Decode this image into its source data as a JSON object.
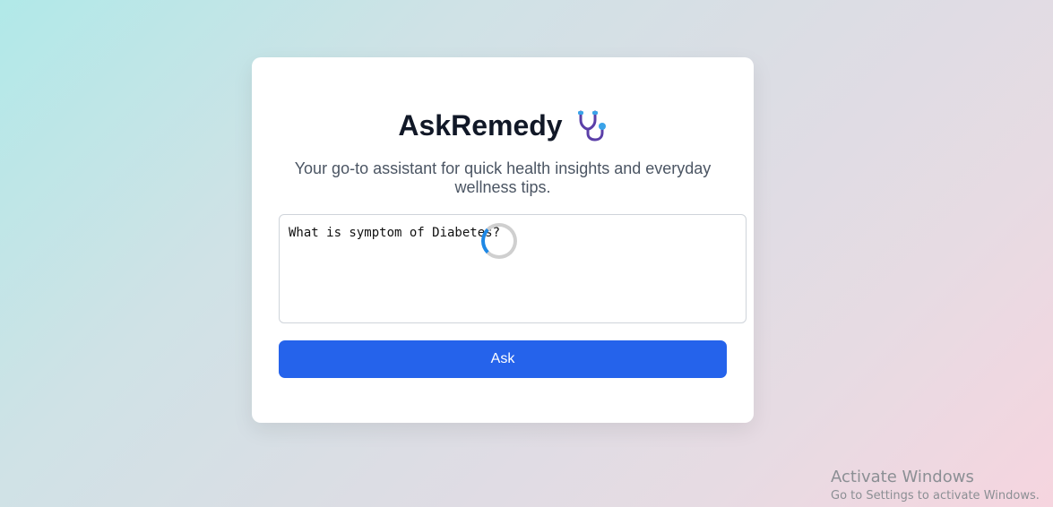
{
  "app": {
    "title": "AskRemedy",
    "icon": "stethoscope-icon",
    "subtitle": "Your go-to assistant for quick health insights and everyday wellness tips."
  },
  "query": {
    "value": "What is symptom of Diabetes?"
  },
  "actions": {
    "ask_label": "Ask"
  },
  "status": {
    "loading": true
  },
  "watermark": {
    "line1": "Activate Windows",
    "line2": "Go to Settings to activate Windows."
  },
  "colors": {
    "accent": "#2563eb",
    "spinner": "#1e88e5",
    "title": "#111827"
  }
}
